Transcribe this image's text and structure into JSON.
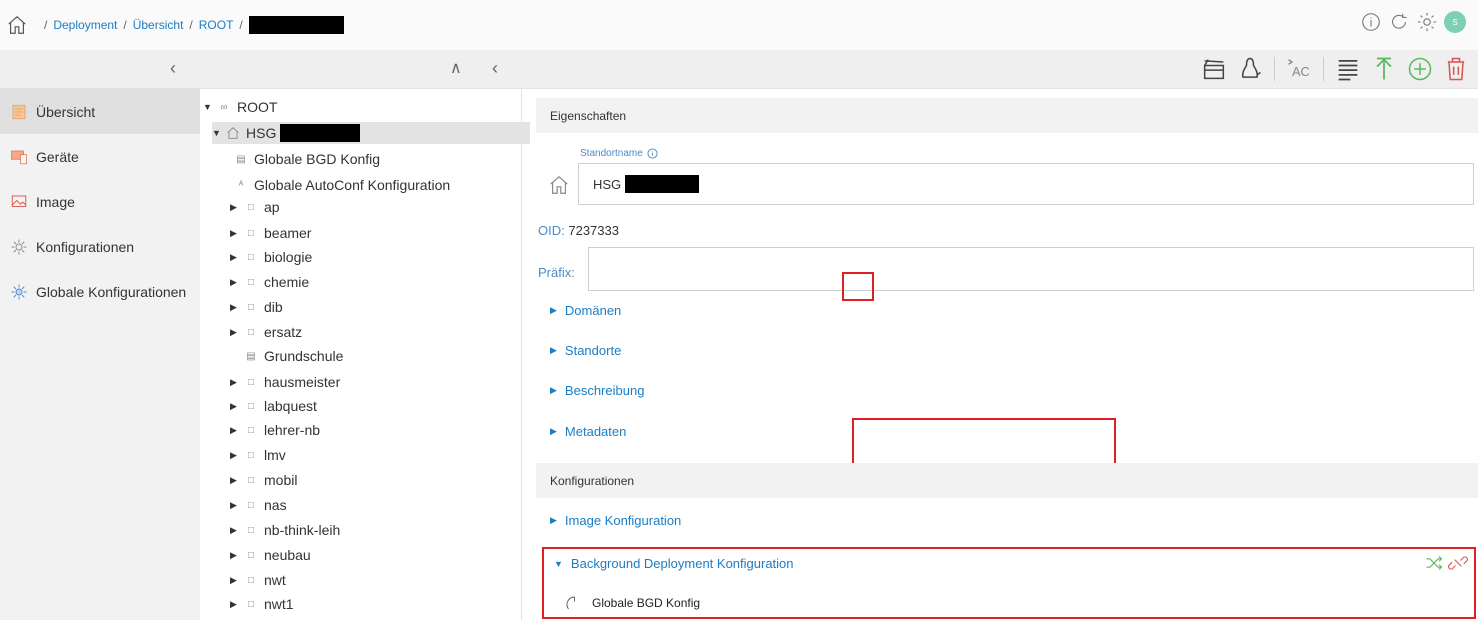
{
  "header": {
    "breadcrumbs": [
      "Deployment",
      "Übersicht",
      "ROOT"
    ],
    "separator": "/",
    "avatar_initial": "S"
  },
  "sidebar": {
    "items": [
      {
        "label": "Übersicht",
        "icon": "overview-icon",
        "active": true
      },
      {
        "label": "Geräte",
        "icon": "devices-icon",
        "active": false
      },
      {
        "label": "Image",
        "icon": "image-icon",
        "active": false
      },
      {
        "label": "Konfigurationen",
        "icon": "config-gear-icon",
        "active": false
      },
      {
        "label": "Globale Konfigurationen",
        "icon": "global-config-icon",
        "active": false
      }
    ]
  },
  "tree": {
    "root": "ROOT",
    "site": "HSG",
    "config_items": [
      "Globale BGD Konfig",
      "Globale AutoConf Konfiguration"
    ],
    "groups": [
      "ap",
      "beamer",
      "biologie",
      "chemie",
      "dib",
      "ersatz",
      "Grundschule",
      "hausmeister",
      "labquest",
      "lehrer-nb",
      "lmv",
      "mobil",
      "nas",
      "nb-think-leih",
      "neubau",
      "nwt",
      "nwt1"
    ]
  },
  "main": {
    "properties_header": "Eigenschaften",
    "site_name_label": "Standortname",
    "site_name_value": "HSG",
    "oid_label": "OID:",
    "oid_value": "7237333",
    "prefix_label": "Präfix:",
    "expanders": [
      "Domänen",
      "Standorte",
      "Beschreibung",
      "Metadaten"
    ],
    "configs_header": "Konfigurationen",
    "image_config": "Image Konfiguration",
    "bgd_config": "Background Deployment Konfiguration",
    "bgd_item": "Globale BGD Konfig"
  },
  "colors": {
    "link": "#1b7dc5",
    "highlight": "#e02020",
    "add_green": "#5cb85c",
    "delete_red": "#d9534f",
    "avatar": "#7fcfb4"
  }
}
